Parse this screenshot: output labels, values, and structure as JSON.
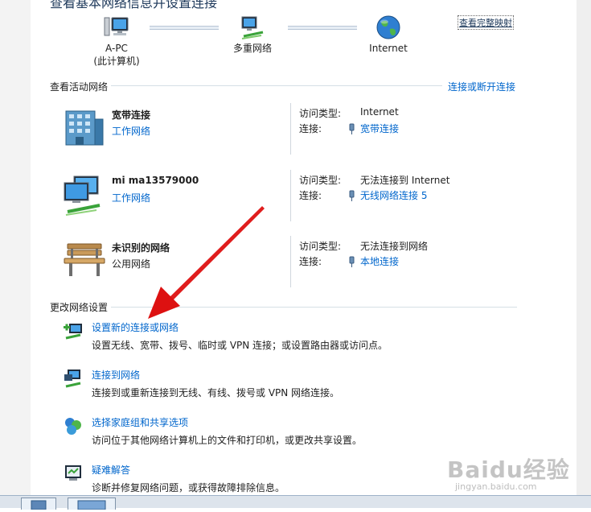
{
  "header": {
    "title": "查看基本网络信息并设置连接",
    "map_link": "查看完整映射"
  },
  "network_map": {
    "nodes": [
      {
        "label": "A-PC",
        "sublabel": "(此计算机)"
      },
      {
        "label": "多重网络",
        "sublabel": ""
      },
      {
        "label": "Internet",
        "sublabel": ""
      }
    ]
  },
  "active_networks": {
    "title": "查看活动网络",
    "connect_link": "连接或断开连接",
    "items": [
      {
        "name": "宽带连接",
        "type": "工作网络",
        "access_label": "访问类型:",
        "access_value": "Internet",
        "conn_label": "连接:",
        "conn_value": "宽带连接"
      },
      {
        "name": "mi ma13579000",
        "type": "工作网络",
        "access_label": "访问类型:",
        "access_value": "无法连接到 Internet",
        "conn_label": "连接:",
        "conn_value": "无线网络连接 5"
      },
      {
        "name": "未识别的网络",
        "type": "公用网络",
        "access_label": "访问类型:",
        "access_value": "无法连接到网络",
        "conn_label": "连接:",
        "conn_value": "本地连接"
      }
    ]
  },
  "change_settings": {
    "title": "更改网络设置",
    "tasks": [
      {
        "link": "设置新的连接或网络",
        "desc": "设置无线、宽带、拨号、临时或 VPN 连接；或设置路由器或访问点。"
      },
      {
        "link": "连接到网络",
        "desc": "连接到或重新连接到无线、有线、拨号或 VPN 网络连接。"
      },
      {
        "link": "选择家庭组和共享选项",
        "desc": "访问位于其他网络计算机上的文件和打印机，或更改共享设置。"
      },
      {
        "link": "疑难解答",
        "desc": "诊断并修复网络问题，或获得故障排除信息。"
      }
    ]
  },
  "watermark": {
    "main": "Baidu经验",
    "sub": "jingyan.baidu.com"
  },
  "colors": {
    "link": "#0066cc",
    "arrow": "#e0141e"
  }
}
